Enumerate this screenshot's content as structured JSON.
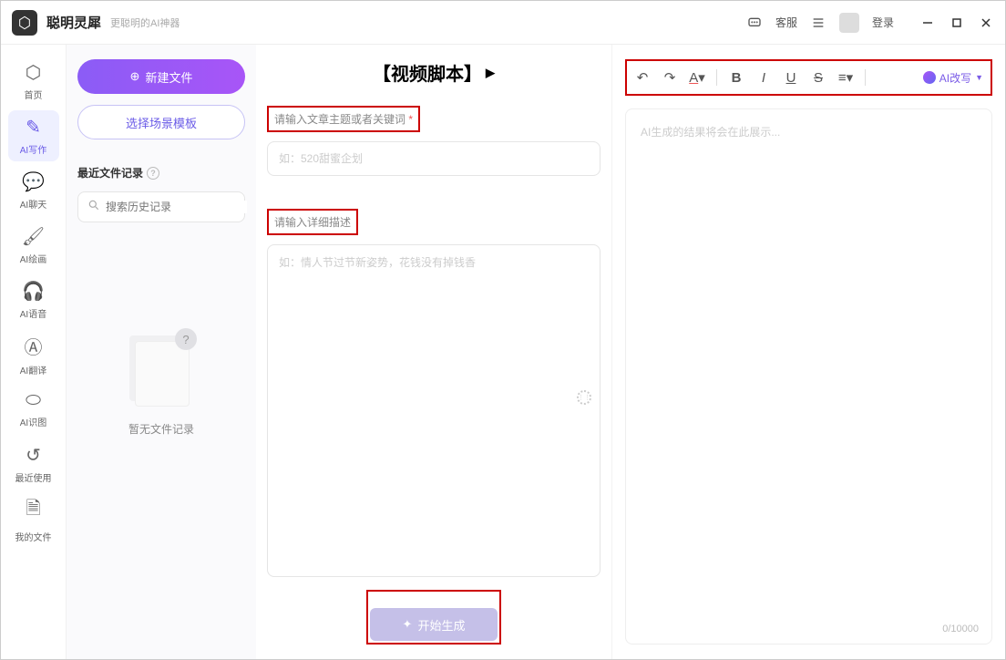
{
  "app": {
    "name": "聪明灵犀",
    "slogan": "更聪明的AI神器"
  },
  "titlebar": {
    "support": "客服",
    "login": "登录"
  },
  "sidebar": {
    "items": [
      {
        "label": "首页"
      },
      {
        "label": "AI写作"
      },
      {
        "label": "AI聊天"
      },
      {
        "label": "AI绘画"
      },
      {
        "label": "AI语音"
      },
      {
        "label": "AI翻译"
      },
      {
        "label": "AI识图"
      },
      {
        "label": "最近使用"
      },
      {
        "label": "我的文件"
      }
    ]
  },
  "leftPanel": {
    "newFile": "新建文件",
    "chooseTemplate": "选择场景模板",
    "recentTitle": "最近文件记录",
    "searchPlaceholder": "搜索历史记录",
    "emptyText": "暂无文件记录"
  },
  "midPanel": {
    "title": "【视频脚本】",
    "label1": "请输入文章主题或者关键词",
    "asterisk": "*",
    "placeholder1": "如：520甜蜜企划",
    "label2": "请输入详细描述",
    "placeholder2": "如：情人节过节新姿势，花钱没有掉钱香",
    "generateBtn": "开始生成"
  },
  "rightPanel": {
    "aiRewrite": "AI改写",
    "outputPlaceholder": "AI生成的结果将会在此展示...",
    "counter": "0/10000"
  }
}
